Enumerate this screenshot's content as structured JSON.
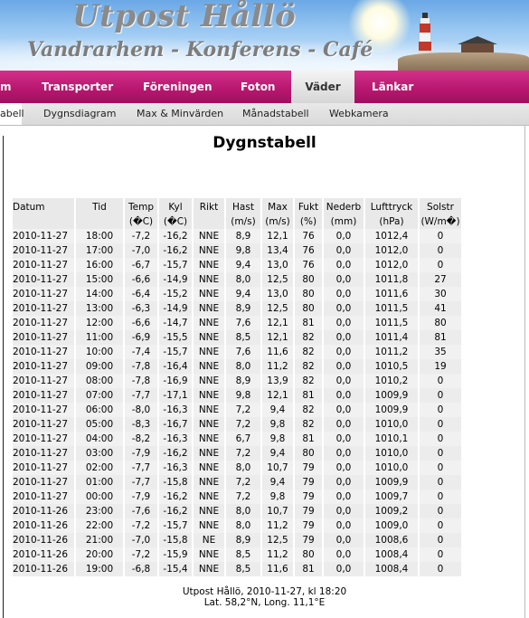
{
  "header": {
    "title": "Utpost Hållö",
    "subtitle": "Vandrarhem - Konferens - Café"
  },
  "mainnav": {
    "items": [
      {
        "label": "m"
      },
      {
        "label": "Transporter"
      },
      {
        "label": "Föreningen"
      },
      {
        "label": "Foton"
      },
      {
        "label": "Väder"
      },
      {
        "label": "Länkar"
      }
    ],
    "active": "Väder"
  },
  "subnav": {
    "items": [
      {
        "label": "abell"
      },
      {
        "label": "Dygnsdiagram"
      },
      {
        "label": "Max & Minvärden"
      },
      {
        "label": "Månadstabell"
      },
      {
        "label": "Webkamera"
      }
    ]
  },
  "page_title": "Dygnstabell",
  "table": {
    "headers": [
      "Datum",
      "Tid",
      "Temp",
      "Kyl",
      "Rikt",
      "Hast",
      "Max",
      "Fukt",
      "Nederb",
      "Lufttryck",
      "Solstr"
    ],
    "units": [
      "",
      "",
      "(�C)",
      "(�C)",
      "",
      "(m/s)",
      "(m/s)",
      "(%)",
      "(mm)",
      "(hPa)",
      "(W/m�)"
    ],
    "rows": [
      [
        "2010-11-27",
        "18:00",
        "-7,2",
        "-16,2",
        "NNE",
        "8,9",
        "12,1",
        "76",
        "0,0",
        "1012,4",
        "0"
      ],
      [
        "2010-11-27",
        "17:00",
        "-7,0",
        "-16,2",
        "NNE",
        "9,8",
        "13,4",
        "76",
        "0,0",
        "1012,0",
        "0"
      ],
      [
        "2010-11-27",
        "16:00",
        "-6,7",
        "-15,7",
        "NNE",
        "9,4",
        "13,0",
        "76",
        "0,0",
        "1012,0",
        "0"
      ],
      [
        "2010-11-27",
        "15:00",
        "-6,6",
        "-14,9",
        "NNE",
        "8,0",
        "12,5",
        "80",
        "0,0",
        "1011,8",
        "27"
      ],
      [
        "2010-11-27",
        "14:00",
        "-6,4",
        "-15,2",
        "NNE",
        "9,4",
        "13,0",
        "80",
        "0,0",
        "1011,6",
        "30"
      ],
      [
        "2010-11-27",
        "13:00",
        "-6,3",
        "-14,9",
        "NNE",
        "8,9",
        "12,5",
        "80",
        "0,0",
        "1011,5",
        "41"
      ],
      [
        "2010-11-27",
        "12:00",
        "-6,6",
        "-14,7",
        "NNE",
        "7,6",
        "12,1",
        "81",
        "0,0",
        "1011,5",
        "80"
      ],
      [
        "2010-11-27",
        "11:00",
        "-6,9",
        "-15,5",
        "NNE",
        "8,5",
        "12,1",
        "82",
        "0,0",
        "1011,4",
        "81"
      ],
      [
        "2010-11-27",
        "10:00",
        "-7,4",
        "-15,7",
        "NNE",
        "7,6",
        "11,6",
        "82",
        "0,0",
        "1011,2",
        "35"
      ],
      [
        "2010-11-27",
        "09:00",
        "-7,8",
        "-16,4",
        "NNE",
        "8,0",
        "11,2",
        "82",
        "0,0",
        "1010,5",
        "19"
      ],
      [
        "2010-11-27",
        "08:00",
        "-7,8",
        "-16,9",
        "NNE",
        "8,9",
        "13,9",
        "82",
        "0,0",
        "1010,2",
        "0"
      ],
      [
        "2010-11-27",
        "07:00",
        "-7,7",
        "-17,1",
        "NNE",
        "9,8",
        "12,1",
        "81",
        "0,0",
        "1009,9",
        "0"
      ],
      [
        "2010-11-27",
        "06:00",
        "-8,0",
        "-16,3",
        "NNE",
        "7,2",
        "9,4",
        "82",
        "0,0",
        "1009,9",
        "0"
      ],
      [
        "2010-11-27",
        "05:00",
        "-8,3",
        "-16,7",
        "NNE",
        "7,2",
        "9,8",
        "82",
        "0,0",
        "1010,0",
        "0"
      ],
      [
        "2010-11-27",
        "04:00",
        "-8,2",
        "-16,3",
        "NNE",
        "6,7",
        "9,8",
        "81",
        "0,0",
        "1010,1",
        "0"
      ],
      [
        "2010-11-27",
        "03:00",
        "-7,9",
        "-16,2",
        "NNE",
        "7,2",
        "9,4",
        "80",
        "0,0",
        "1010,0",
        "0"
      ],
      [
        "2010-11-27",
        "02:00",
        "-7,7",
        "-16,3",
        "NNE",
        "8,0",
        "10,7",
        "79",
        "0,0",
        "1010,0",
        "0"
      ],
      [
        "2010-11-27",
        "01:00",
        "-7,7",
        "-15,8",
        "NNE",
        "7,2",
        "9,4",
        "79",
        "0,0",
        "1009,9",
        "0"
      ],
      [
        "2010-11-27",
        "00:00",
        "-7,9",
        "-16,2",
        "NNE",
        "7,2",
        "9,8",
        "79",
        "0,0",
        "1009,7",
        "0"
      ],
      [
        "2010-11-26",
        "23:00",
        "-7,6",
        "-16,2",
        "NNE",
        "8,0",
        "10,7",
        "79",
        "0,0",
        "1009,2",
        "0"
      ],
      [
        "2010-11-26",
        "22:00",
        "-7,2",
        "-15,7",
        "NNE",
        "8,0",
        "11,2",
        "79",
        "0,0",
        "1009,0",
        "0"
      ],
      [
        "2010-11-26",
        "21:00",
        "-7,0",
        "-15,8",
        "NE",
        "8,9",
        "12,5",
        "79",
        "0,0",
        "1008,6",
        "0"
      ],
      [
        "2010-11-26",
        "20:00",
        "-7,2",
        "-15,9",
        "NNE",
        "8,5",
        "11,2",
        "80",
        "0,0",
        "1008,4",
        "0"
      ],
      [
        "2010-11-26",
        "19:00",
        "-6,8",
        "-15,4",
        "NNE",
        "8,5",
        "11,6",
        "81",
        "0,0",
        "1008,4",
        "0"
      ]
    ]
  },
  "footer": {
    "line1": "Utpost Hållö, 2010-11-27, kl 18:20",
    "line2": "Lat. 58,2°N, Long. 11,1°E"
  }
}
